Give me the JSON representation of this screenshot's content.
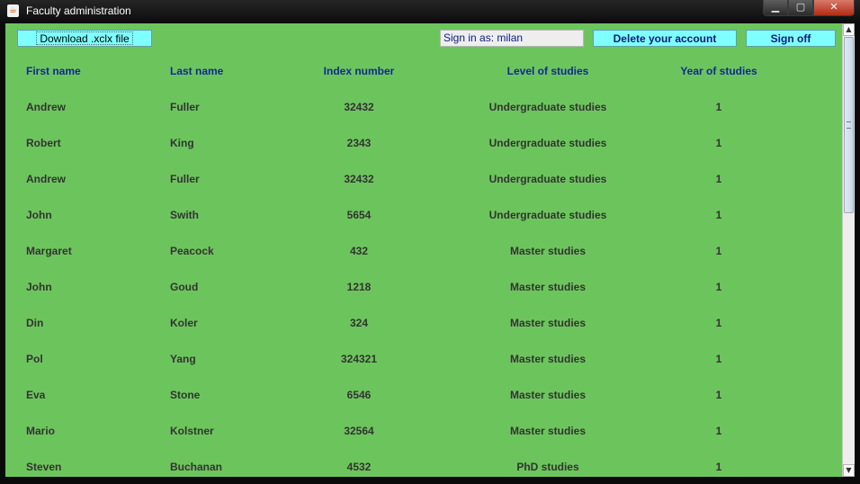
{
  "window": {
    "title": "Faculty administration",
    "app_icon": "java-icon",
    "controls": [
      "minimize-icon",
      "maximize-icon",
      "close-icon"
    ]
  },
  "toolbar": {
    "download_label": "Download .xclx file",
    "signed_in_text": "Sign in as: milan",
    "delete_label": "Delete your account",
    "signoff_label": "Sign off"
  },
  "table": {
    "headers": [
      "First name",
      "Last name",
      "Index number",
      "Level of studies",
      "Year of studies"
    ],
    "rows": [
      [
        "Andrew",
        "Fuller",
        "32432",
        "Undergraduate studies",
        "1"
      ],
      [
        "Robert",
        "King",
        "2343",
        "Undergraduate studies",
        "1"
      ],
      [
        "Andrew",
        "Fuller",
        "32432",
        "Undergraduate studies",
        "1"
      ],
      [
        "John",
        "Swith",
        "5654",
        "Undergraduate studies",
        "1"
      ],
      [
        "Margaret",
        "Peacock",
        "432",
        "Master studies",
        "1"
      ],
      [
        "John",
        "Goud",
        "1218",
        "Master studies",
        "1"
      ],
      [
        "Din",
        "Koler",
        "324",
        "Master studies",
        "1"
      ],
      [
        "Pol",
        "Yang",
        "324321",
        "Master studies",
        "1"
      ],
      [
        "Eva",
        "Stone",
        "6546",
        "Master studies",
        "1"
      ],
      [
        "Mario",
        "Kolstner",
        "32564",
        "Master studies",
        "1"
      ],
      [
        "Steven",
        "Buchanan",
        "4532",
        "PhD studies",
        "1"
      ]
    ]
  },
  "colors": {
    "background": "#6cc55c",
    "button": "#7fffff",
    "header_text": "#112a96",
    "cell_text": "#333333"
  }
}
